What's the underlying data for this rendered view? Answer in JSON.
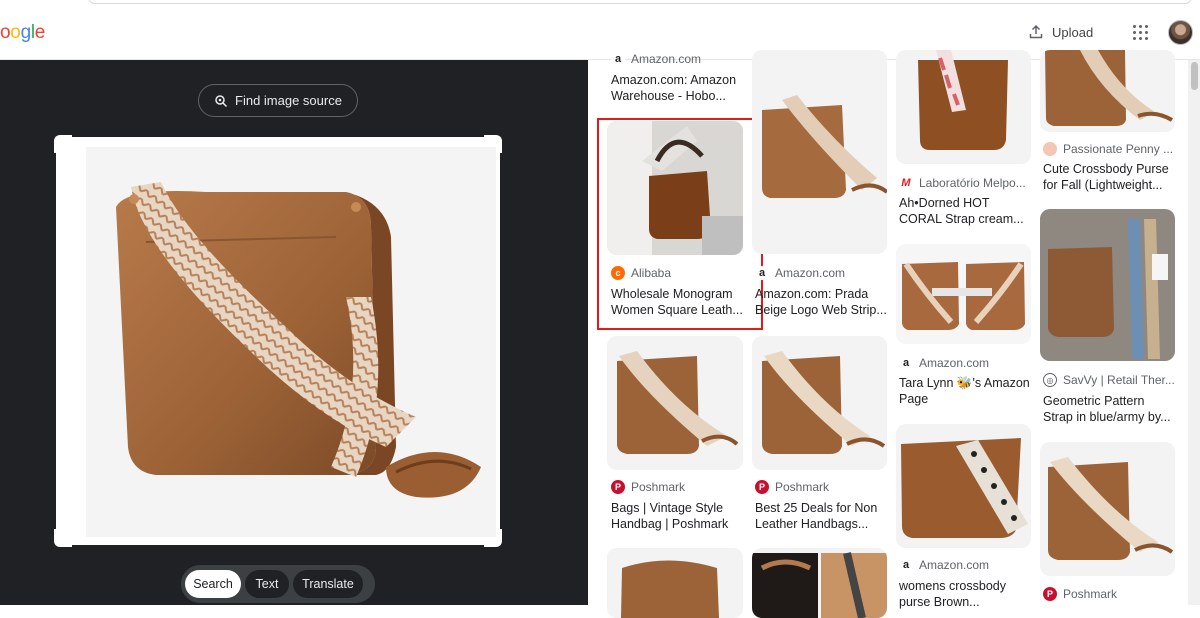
{
  "header": {
    "logo_letters": [
      "o",
      "o",
      "g",
      "l",
      "e"
    ],
    "upload_label": "Upload"
  },
  "left": {
    "find_source_label": "Find image source",
    "modes": [
      {
        "label": "Search",
        "active": true
      },
      {
        "label": "Text",
        "active": false
      },
      {
        "label": "Translate",
        "active": false
      }
    ]
  },
  "results": {
    "columns": [
      [
        {
          "source": "Amazon.com",
          "title": "Amazon.com: Amazon Warehouse - Hobo...",
          "favicon": "amazon-icon"
        },
        {
          "source": "Alibaba",
          "title": "Wholesale Monogram Women Square Leath...",
          "favicon": "alibaba-icon",
          "highlighted": true
        },
        {
          "source": "Poshmark",
          "title": "Bags | Vintage Style Handbag | Poshmark",
          "favicon": "poshmark-icon"
        },
        {
          "source": "",
          "title": "",
          "favicon": ""
        }
      ],
      [
        {
          "source": "Amazon.com",
          "title": "Amazon.com: Prada Beige Logo Web Strip...",
          "favicon": "amazon-icon"
        },
        {
          "source": "Poshmark",
          "title": "Best 25 Deals for Non Leather Handbags...",
          "favicon": "poshmark-icon"
        },
        {
          "source": "",
          "title": "",
          "favicon": ""
        }
      ],
      [
        {
          "source": "Laboratório Melpo...",
          "title": "Ah•Dorned HOT CORAL Strap cream...",
          "favicon": "melpo-icon"
        },
        {
          "source": "Amazon.com",
          "title": "Tara Lynn 🐝's Amazon Page",
          "favicon": "amazon-icon"
        },
        {
          "source": "Amazon.com",
          "title": "womens crossbody purse Brown...",
          "favicon": "amazon-icon"
        }
      ],
      [
        {
          "source": "Passionate Penny ...",
          "title": "Cute Crossbody Purse for Fall (Lightweight...",
          "favicon": "passionate-penny-icon"
        },
        {
          "source": "SavVy | Retail Ther...",
          "title": "Geometric Pattern Strap in blue/army by...",
          "favicon": "globe-icon"
        },
        {
          "source": "Poshmark",
          "title": "",
          "favicon": "poshmark-icon"
        }
      ]
    ]
  },
  "colors": {
    "dark_panel": "#202124",
    "highlight_box": "#e01b1b",
    "bag_brown": "#a0673c"
  }
}
